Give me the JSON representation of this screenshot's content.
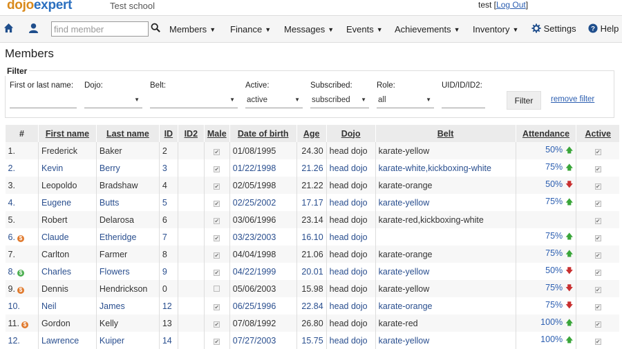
{
  "brand": {
    "logo_part1": "dojo",
    "logo_part2": "expert",
    "school": "Test school"
  },
  "user": {
    "name": "test",
    "logout_label": "Log Out"
  },
  "nav": {
    "search_placeholder": "find member",
    "menus": [
      "Members",
      "Finance",
      "Messages",
      "Events",
      "Achievements",
      "Inventory"
    ],
    "settings_label": "Settings",
    "help_label": "Help"
  },
  "page": {
    "title": "Members"
  },
  "filter": {
    "legend": "Filter",
    "name_label": "First or last name:",
    "name_value": "",
    "dojo_label": "Dojo:",
    "dojo_value": "",
    "belt_label": "Belt:",
    "belt_value": "",
    "active_label": "Active:",
    "active_value": "active",
    "subscribed_label": "Subscribed:",
    "subscribed_value": "subscribed",
    "role_label": "Role:",
    "role_value": "all",
    "uid_label": "UID/ID/ID2:",
    "uid_value": "",
    "filter_button": "Filter",
    "remove_filter": "remove filter"
  },
  "table": {
    "headers": [
      "#",
      "First name",
      "Last name",
      "ID",
      "ID2",
      "Male",
      "Date of birth",
      "Age",
      "Dojo",
      "Belt",
      "Attendance",
      "Active"
    ],
    "rows": [
      {
        "num": "1.",
        "badge": "",
        "first": "Frederick",
        "last": "Baker",
        "id": "2",
        "id2": "",
        "male": true,
        "dob": "01/08/1995",
        "age": "24.30",
        "dojo": "head dojo",
        "belt": "karate-yellow",
        "att": "50%",
        "trend": "up",
        "active": true,
        "link": false
      },
      {
        "num": "2.",
        "badge": "",
        "first": "Kevin",
        "last": "Berry",
        "id": "3",
        "id2": "",
        "male": true,
        "dob": "01/22/1998",
        "age": "21.26",
        "dojo": "head dojo",
        "belt": "karate-white,kickboxing-white",
        "att": "75%",
        "trend": "up",
        "active": true,
        "link": true
      },
      {
        "num": "3.",
        "badge": "",
        "first": "Leopoldo",
        "last": "Bradshaw",
        "id": "4",
        "id2": "",
        "male": true,
        "dob": "02/05/1998",
        "age": "21.22",
        "dojo": "head dojo",
        "belt": "karate-orange",
        "att": "50%",
        "trend": "down",
        "active": true,
        "link": false
      },
      {
        "num": "4.",
        "badge": "",
        "first": "Eugene",
        "last": "Butts",
        "id": "5",
        "id2": "",
        "male": true,
        "dob": "02/25/2002",
        "age": "17.17",
        "dojo": "head dojo",
        "belt": "karate-yellow",
        "att": "75%",
        "trend": "up",
        "active": true,
        "link": true
      },
      {
        "num": "5.",
        "badge": "",
        "first": "Robert",
        "last": "Delarosa",
        "id": "6",
        "id2": "",
        "male": true,
        "dob": "03/06/1996",
        "age": "23.14",
        "dojo": "head dojo",
        "belt": "karate-red,kickboxing-white",
        "att": "",
        "trend": "",
        "active": true,
        "link": false
      },
      {
        "num": "6.",
        "badge": "orange",
        "first": "Claude",
        "last": "Etheridge",
        "id": "7",
        "id2": "",
        "male": true,
        "dob": "03/23/2003",
        "age": "16.10",
        "dojo": "head dojo",
        "belt": "",
        "att": "75%",
        "trend": "up",
        "active": true,
        "link": true
      },
      {
        "num": "7.",
        "badge": "",
        "first": "Carlton",
        "last": "Farmer",
        "id": "8",
        "id2": "",
        "male": true,
        "dob": "04/04/1998",
        "age": "21.06",
        "dojo": "head dojo",
        "belt": "karate-orange",
        "att": "75%",
        "trend": "up",
        "active": true,
        "link": false
      },
      {
        "num": "8.",
        "badge": "green",
        "first": "Charles",
        "last": "Flowers",
        "id": "9",
        "id2": "",
        "male": true,
        "dob": "04/22/1999",
        "age": "20.01",
        "dojo": "head dojo",
        "belt": "karate-yellow",
        "att": "50%",
        "trend": "down",
        "active": true,
        "link": true
      },
      {
        "num": "9.",
        "badge": "orange",
        "first": "Dennis",
        "last": "Hendrickson",
        "id": "0",
        "id2": "",
        "male": false,
        "dob": "05/06/2003",
        "age": "15.98",
        "dojo": "head dojo",
        "belt": "karate-yellow",
        "att": "75%",
        "trend": "down",
        "active": true,
        "link": false
      },
      {
        "num": "10.",
        "badge": "",
        "first": "Neil",
        "last": "James",
        "id": "12",
        "id2": "",
        "male": true,
        "dob": "06/25/1996",
        "age": "22.84",
        "dojo": "head dojo",
        "belt": "karate-orange",
        "att": "75%",
        "trend": "down",
        "active": true,
        "link": true
      },
      {
        "num": "11.",
        "badge": "orange",
        "first": "Gordon",
        "last": "Kelly",
        "id": "13",
        "id2": "",
        "male": true,
        "dob": "07/08/1992",
        "age": "26.80",
        "dojo": "head dojo",
        "belt": "karate-red",
        "att": "100%",
        "trend": "up",
        "active": true,
        "link": false
      },
      {
        "num": "12.",
        "badge": "",
        "first": "Lawrence",
        "last": "Kuiper",
        "id": "14",
        "id2": "",
        "male": true,
        "dob": "07/27/2003",
        "age": "15.75",
        "dojo": "head dojo",
        "belt": "karate-yellow",
        "att": "100%",
        "trend": "up",
        "active": true,
        "link": true
      }
    ]
  },
  "colors": {
    "link": "#2a4f8f",
    "logo_orange": "#d98a1c",
    "logo_blue": "#2a6fbf",
    "up": "#3aa53a",
    "down": "#c83030",
    "badge_orange": "#e07a2e",
    "badge_green": "#4caf50"
  }
}
